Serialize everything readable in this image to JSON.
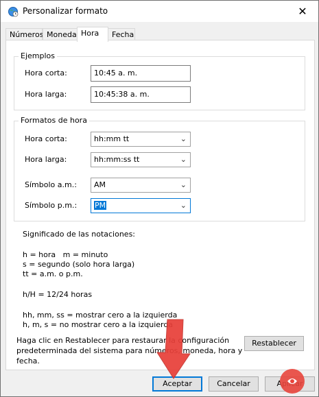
{
  "window": {
    "title": "Personalizar formato",
    "close_label": "✕"
  },
  "tabs": [
    {
      "label": "Números"
    },
    {
      "label": "Moneda"
    },
    {
      "label": "Hora"
    },
    {
      "label": "Fecha"
    }
  ],
  "examples": {
    "group_title": "Ejemplos",
    "short_label": "Hora corta:",
    "short_value": "10:45 a. m.",
    "long_label": "Hora larga:",
    "long_value": "10:45:38 a. m."
  },
  "formats": {
    "group_title": "Formatos de hora",
    "short_label": "Hora corta:",
    "short_value": "hh:mm tt",
    "long_label": "Hora larga:",
    "long_value": "hh:mm:ss tt",
    "am_label": "Símbolo a.m.:",
    "am_value": "AM",
    "pm_label": "Símbolo p.m.:",
    "pm_value": "PM"
  },
  "notes": {
    "heading": "Significado de las notaciones:",
    "line1": "h = hora   m = minuto",
    "line2": "s = segundo (solo hora larga)",
    "line3": "tt = a.m. o p.m.",
    "line4": "h/H = 12/24 horas",
    "line5": "hh, mm, ss = mostrar cero a la izquierda",
    "line6": "h, m, s = no mostrar cero a la izquierda"
  },
  "reset": {
    "text_line1": "Haga clic en Restablecer para restaurar la configuración",
    "text_line2": "predeterminada del sistema para números, moneda, hora y",
    "text_line3": "fecha.",
    "button": "Restablecer"
  },
  "footer": {
    "accept": "Aceptar",
    "cancel": "Cancelar",
    "apply": "Aplicar"
  },
  "colors": {
    "accent": "#0078d7",
    "arrow": "#e8403a",
    "logo": "#e8453c"
  },
  "icons": {
    "title": "globe-clock-icon",
    "chevron": "chevron-down-icon"
  }
}
